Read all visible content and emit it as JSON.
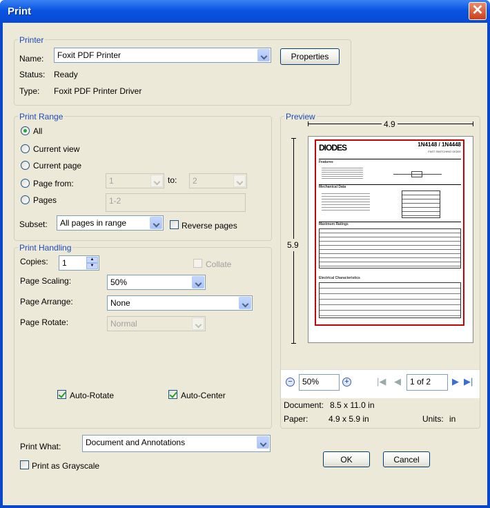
{
  "window": {
    "title": "Print",
    "close_glyph": "✕"
  },
  "printer": {
    "group_label": "Printer",
    "name_label": "Name:",
    "name_value": "Foxit PDF Printer",
    "properties_label": "Properties",
    "status_label": "Status:",
    "status_value": "Ready",
    "type_label": "Type:",
    "type_value": "Foxit PDF Printer Driver"
  },
  "print_range": {
    "group_label": "Print Range",
    "all_label": "All",
    "current_view_label": "Current view",
    "current_page_label": "Current page",
    "page_from_label": "Page from:",
    "page_from_value": "1",
    "to_label": "to:",
    "page_to_value": "2",
    "pages_label": "Pages",
    "pages_value": "1-2",
    "subset_label": "Subset:",
    "subset_value": "All pages in range",
    "reverse_pages_label": "Reverse pages",
    "selected": "All"
  },
  "print_handling": {
    "group_label": "Print Handling",
    "copies_label": "Copies:",
    "copies_value": "1",
    "collate_label": "Collate",
    "page_scaling_label": "Page Scaling:",
    "page_scaling_value": "50%",
    "page_arrange_label": "Page Arrange:",
    "page_arrange_value": "None",
    "page_rotate_label": "Page Rotate:",
    "page_rotate_value": "Normal",
    "auto_rotate_label": "Auto-Rotate",
    "auto_rotate_checked": true,
    "auto_center_label": "Auto-Center",
    "auto_center_checked": true
  },
  "print_what": {
    "label": "Print What:",
    "value": "Document and Annotations"
  },
  "grayscale": {
    "label": "Print as Grayscale",
    "checked": false
  },
  "buttons": {
    "ok": "OK",
    "cancel": "Cancel"
  },
  "preview": {
    "group_label": "Preview",
    "width_label": "4.9",
    "height_label": "5.9",
    "zoom_value": "50%",
    "page_indicator": "1 of 2",
    "document_label": "Document:",
    "document_size": "8.5 x 11.0 in",
    "paper_label": "Paper:",
    "paper_size": "4.9 x 5.9 in",
    "units_label": "Units:",
    "units_value": "in",
    "thumb": {
      "logo": "DIODES",
      "part": "1N4148 / 1N4448",
      "subtitle": "FAST SWITCHING DIODE",
      "features": "Features",
      "mech": "Mechanical Data",
      "ratings": "Maximum Ratings",
      "elec": "Electrical Characteristics"
    }
  },
  "colors": {
    "accent": "#1c4ab8",
    "title_bar": "#0a55e3",
    "preview_border": "#cc0000"
  }
}
